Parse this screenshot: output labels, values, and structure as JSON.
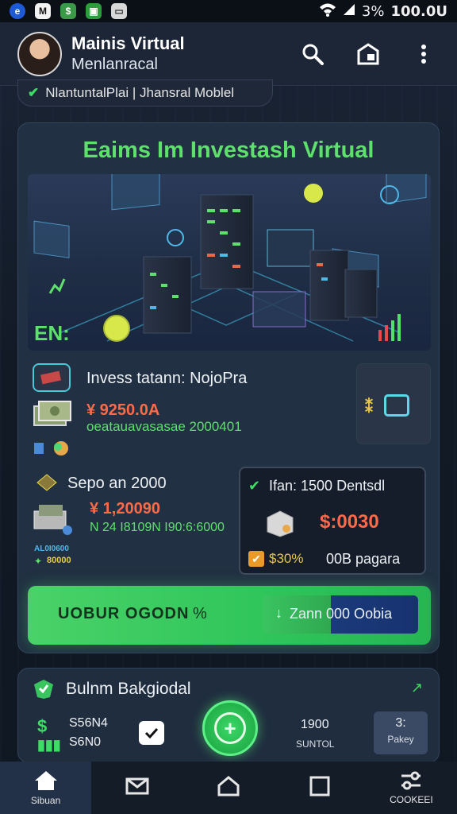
{
  "status_bar": {
    "battery": "3%",
    "time": "100.0U"
  },
  "header": {
    "title": "Mainis Virtual",
    "subtitle": "Menlanracal"
  },
  "pill": {
    "label": "NlantuntalPlai | Jhansral Moblel"
  },
  "card": {
    "title": "Eaims Im Investash Virtual",
    "en_label": "EN:"
  },
  "invest_panel": {
    "title": "Invess tatann: NojoPra",
    "value": "¥ 9250.0A",
    "detail": "oeatauavasasae 2000401"
  },
  "left_panel": {
    "title": "Sepo an 2000",
    "value": "¥ 1,20090",
    "detail": "N 24 I8109N  I90:6:6000",
    "small1": "AL0I0600",
    "small2": "80000"
  },
  "right_panel": {
    "title": "Ifan: 1500 Dentsdl",
    "price": "$:0030",
    "percent": "$30%",
    "note": "00B pagara"
  },
  "green_button": {
    "label": "UOBUR OGODN",
    "secondary": "Zann 000 Oobia"
  },
  "bottom_card": {
    "title": "Bulnm Bakgiodal",
    "stat1": "S56N4",
    "stat2": "S6N0",
    "mid_value": "1900",
    "mid_label": "SUNTOL",
    "right_value": "3:",
    "right_label": "Pakey"
  },
  "nav": {
    "items": [
      {
        "label": "Sibuan",
        "icon": "home-icon"
      },
      {
        "label": "",
        "icon": "mail-icon"
      },
      {
        "label": "",
        "icon": "house-outline-icon"
      },
      {
        "label": "",
        "icon": "square-icon"
      },
      {
        "label": "COOKEEI",
        "icon": "settings-icon"
      }
    ]
  },
  "colors": {
    "accent_green": "#5ee06c",
    "price_orange": "#ff6a4a",
    "card_bg": "#213042"
  }
}
